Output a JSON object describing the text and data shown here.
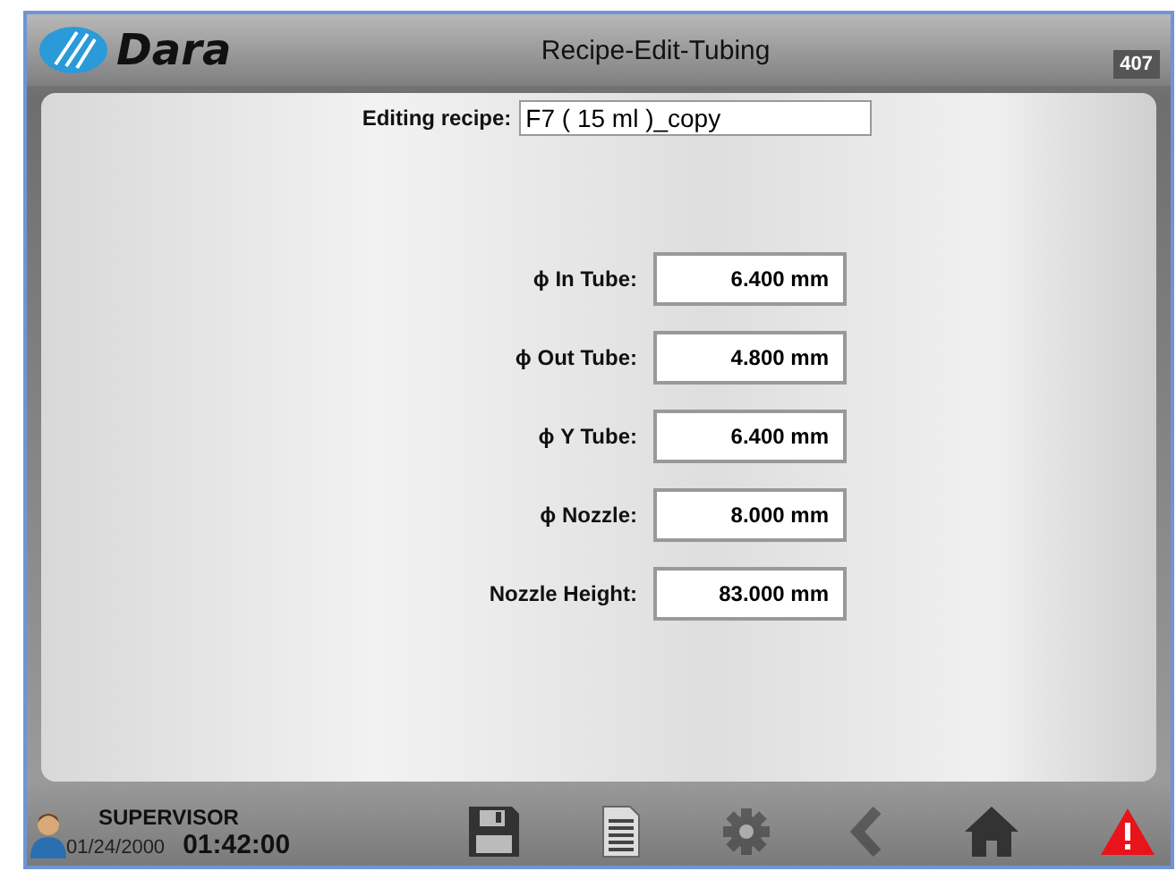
{
  "header": {
    "brand": "Dara",
    "title": "Recipe-Edit-Tubing",
    "screen_number": "407"
  },
  "recipe": {
    "label": "Editing recipe:",
    "value": "F7 ( 15 ml )_copy"
  },
  "fields": [
    {
      "label": "ϕ In Tube:",
      "value": "6.400 mm"
    },
    {
      "label": "ϕ Out Tube:",
      "value": "4.800 mm"
    },
    {
      "label": "ϕ Y Tube:",
      "value": "6.400 mm"
    },
    {
      "label": "ϕ Nozzle:",
      "value": "8.000 mm"
    },
    {
      "label": "Nozzle Height:",
      "value": "83.000 mm"
    }
  ],
  "status_bar": {
    "user": "SUPERVISOR",
    "date": "01/24/2000",
    "time": "01:42:00"
  },
  "toolbar": [
    {
      "kind": "save",
      "disabled": false
    },
    {
      "kind": "document",
      "disabled": false
    },
    {
      "kind": "settings",
      "disabled": true
    },
    {
      "kind": "back",
      "disabled": true
    },
    {
      "kind": "home",
      "disabled": false
    },
    {
      "kind": "alarm",
      "disabled": false
    }
  ]
}
